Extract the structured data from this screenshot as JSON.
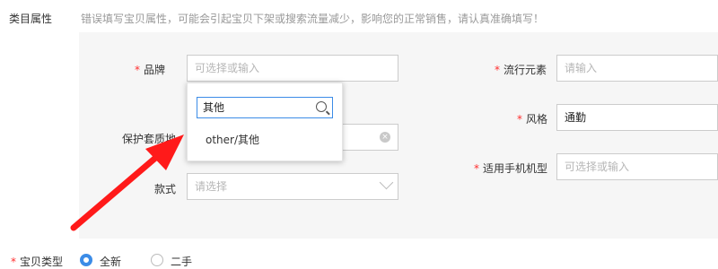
{
  "section": {
    "label": "类目属性",
    "hint": "错误填写宝贝属性，可能会引起宝贝下架或搜索流量减少，影响您的正常销售，请认真准确填写！"
  },
  "fields": {
    "brand": {
      "required": "*",
      "label": "品牌",
      "placeholder": "可选择或输入"
    },
    "protect_material": {
      "label": "保护套质地",
      "value": ""
    },
    "style": {
      "label": "款式",
      "placeholder": "请选择"
    },
    "trend": {
      "required": "*",
      "label": "流行元素",
      "placeholder": "请输入"
    },
    "feng_ge": {
      "required": "*",
      "label": "风格",
      "value": "通勤"
    },
    "phone_model": {
      "required": "*",
      "label": "适用手机机型",
      "placeholder": "可选择或输入"
    }
  },
  "dropdown": {
    "search_value": "其他",
    "options": [
      "other/其他"
    ]
  },
  "item_type": {
    "required": "*",
    "label": "宝贝类型",
    "options": [
      {
        "label": "全新",
        "checked": true
      },
      {
        "label": "二手",
        "checked": false
      }
    ]
  },
  "colors": {
    "accent": "#3c8ce7",
    "required": "#ff2e2e",
    "arrow": "#ff1a1a"
  },
  "icons": {
    "search": "search-icon",
    "clear": "clear-icon",
    "dropdown": "chevron-down-icon"
  }
}
